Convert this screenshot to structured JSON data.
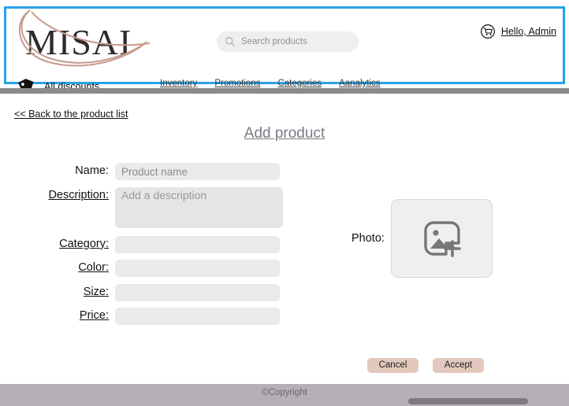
{
  "header": {
    "logo_text": "MISAI",
    "logo_icon": "swoosh-decoration",
    "discounts": {
      "icon": "price-tag-icon",
      "label": "All discounts"
    },
    "search": {
      "icon": "search-icon",
      "placeholder": "Search products",
      "value": ""
    },
    "user": {
      "icon": "shopping-cart-icon",
      "label": "Hello, Admin"
    },
    "nav": [
      {
        "label": "Inventory"
      },
      {
        "label": "Promotions"
      },
      {
        "label": "Categories"
      },
      {
        "label": "Aanalytics"
      }
    ],
    "border_color": "#29a3e8"
  },
  "main": {
    "back_link": "<< Back to the product list",
    "title": "Add product",
    "title_color": "#7f7684",
    "fields": [
      {
        "label": "Name:",
        "underlined": false,
        "placeholder": "Product name",
        "value": ""
      },
      {
        "label": "Description:",
        "underlined": true,
        "placeholder": "Add a description",
        "value": ""
      },
      {
        "label": "Category:",
        "underlined": true,
        "placeholder": "",
        "value": ""
      },
      {
        "label": "Color:",
        "underlined": true,
        "placeholder": "",
        "value": ""
      },
      {
        "label": "Size:",
        "underlined": true,
        "placeholder": "",
        "value": ""
      },
      {
        "label": "Price:",
        "underlined": true,
        "placeholder": "",
        "value": ""
      }
    ],
    "photo": {
      "label": "Photo:",
      "icon": "add-image-icon"
    },
    "buttons": {
      "cancel": "Cancel",
      "accept": "Accept",
      "color": "#e3c8bd"
    }
  },
  "footer": {
    "copyright": "©Copyright",
    "background": "#b5afb6"
  }
}
